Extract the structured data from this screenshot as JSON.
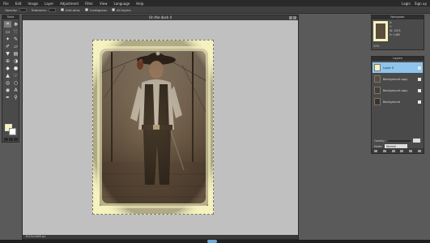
{
  "menu": [
    "File",
    "Edit",
    "Image",
    "Layer",
    "Adjustment",
    "Filter",
    "View",
    "Language",
    "Help"
  ],
  "user_links": [
    "Login",
    "Sign up"
  ],
  "options": {
    "opacity_label": "Opacity:",
    "opacity_value": "100",
    "tolerance_label": "Tolerance:",
    "tolerance_value": "32",
    "antialias_label": "Anti-alias",
    "contiguous_label": "Contiguous",
    "all_layers_label": "All layers"
  },
  "tools": {
    "title": "Tools"
  },
  "document": {
    "title": "On the dock 4",
    "status": "1015x1465 px"
  },
  "navigator": {
    "title": "Navigator",
    "x": "X:",
    "y": "Y:",
    "w": "W: 1035",
    "h": "H: 1465",
    "zoom": "33%"
  },
  "layers": {
    "title": "Layers",
    "items": [
      {
        "label": "Layer 0",
        "active": true
      },
      {
        "label": "Background copy",
        "active": false
      },
      {
        "label": "Background copy",
        "active": false
      },
      {
        "label": "Background",
        "active": false
      }
    ],
    "opacity_label": "Opacity:",
    "opacity_value": "100",
    "blend_label": "Mode:",
    "blend_value": "Normal"
  },
  "colors": {
    "canvas": "#f5f2bf",
    "selected_layer": "#8fc4ec",
    "photo_tone": "#4a3b2c"
  }
}
